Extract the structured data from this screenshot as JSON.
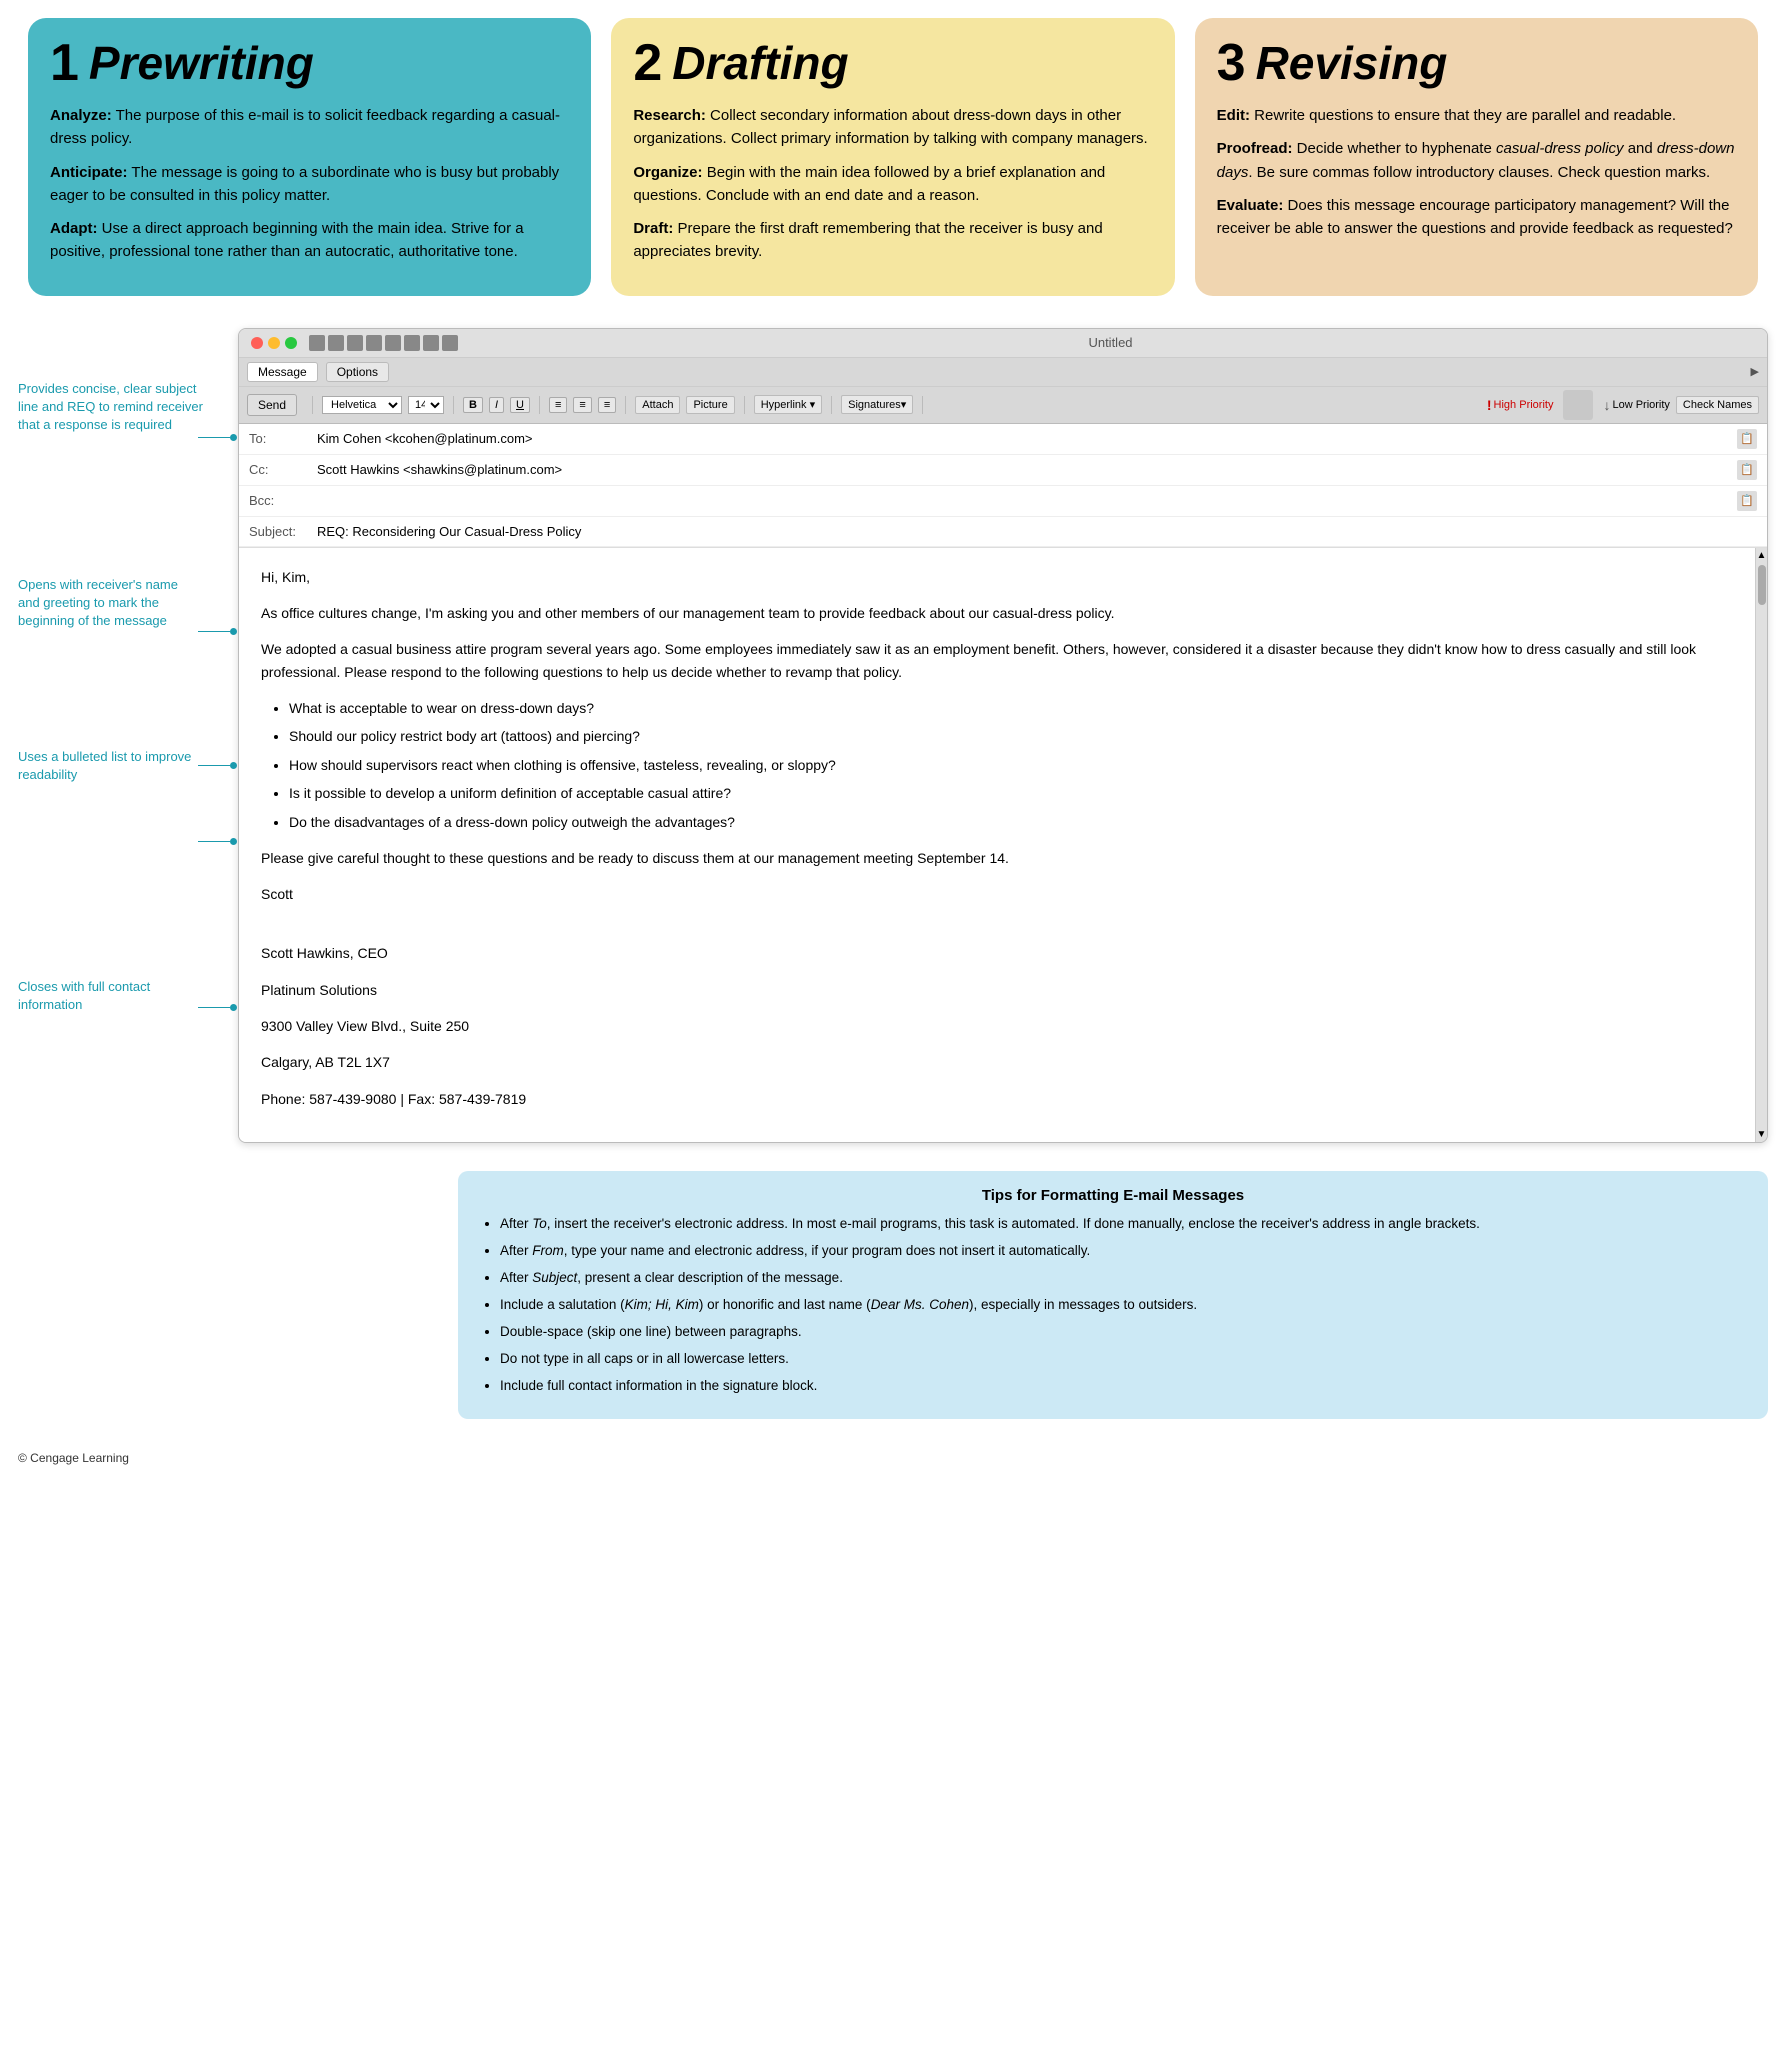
{
  "topPanels": [
    {
      "number": "1",
      "title": "Prewriting",
      "items": [
        {
          "label": "Analyze:",
          "text": "The purpose of this e-mail is to solicit feedback regarding a casual-dress policy."
        },
        {
          "label": "Anticipate:",
          "text": "The message is going to a subordinate who is busy but probably eager to be consulted in this policy matter."
        },
        {
          "label": "Adapt:",
          "text": "Use a direct approach beginning with the main idea. Strive for a positive, professional tone rather than an autocratic, authoritative tone."
        }
      ]
    },
    {
      "number": "2",
      "title": "Drafting",
      "items": [
        {
          "label": "Research:",
          "text": "Collect secondary information about dress-down days in other organizations. Collect primary information by talking with company managers."
        },
        {
          "label": "Organize:",
          "text": "Begin with the main idea followed by a brief explanation and questions. Conclude with an end date and a reason."
        },
        {
          "label": "Draft:",
          "text": "Prepare the first draft remembering that the receiver is busy and appreciates brevity."
        }
      ]
    },
    {
      "number": "3",
      "title": "Revising",
      "items": [
        {
          "label": "Edit:",
          "text": "Rewrite questions to ensure that they are parallel and readable."
        },
        {
          "label": "Proofread:",
          "text": "Decide whether to hyphenate casual-dress policy and dress-down days. Be sure commas follow introductory clauses. Check question marks."
        },
        {
          "label": "Evaluate:",
          "text": "Does this message encourage participatory management? Will the receiver be able to answer the questions and provide feedback as requested?"
        }
      ]
    }
  ],
  "emailWindow": {
    "title": "Untitled",
    "toolbar": {
      "tabs": [
        "Message",
        "Options"
      ],
      "fontFamily": "Helvetica",
      "fontSize": "14",
      "sendBtn": "Send",
      "attachBtn": "Attach",
      "pictureBtn": "Picture",
      "signaturesBtn": "Signatures▾",
      "highPriorityBtn": "High Priority",
      "lowPriorityBtn": "Low Priority",
      "checkNamesBtn": "Check Names",
      "hyperlinkBtn": "Hyperlink ▾"
    },
    "fields": {
      "to": {
        "label": "To:",
        "value": "Kim Cohen <kcohen@platinum.com>"
      },
      "cc": {
        "label": "Cc:",
        "value": "Scott Hawkins <shawkins@platinum.com>"
      },
      "bcc": {
        "label": "Bcc:",
        "value": ""
      },
      "subject": {
        "label": "Subject:",
        "value": "REQ: Reconsidering Our Casual-Dress Policy"
      }
    },
    "body": {
      "greeting": "Hi, Kim,",
      "para1": "As office cultures change, I'm asking you and other members of our management team to provide feedback about our casual-dress policy.",
      "para2": "We adopted a casual business attire program several years ago. Some employees immediately saw it as an employment benefit. Others, however, considered it a disaster because they didn't know how to dress casually and still look professional. Please respond to the following questions to help us decide whether to revamp that policy.",
      "bullets": [
        "What is acceptable to wear on dress-down days?",
        "Should our policy restrict body art (tattoos) and piercing?",
        "How should supervisors react when clothing is offensive, tasteless, revealing, or sloppy?",
        "Is it possible to develop a uniform definition of acceptable casual attire?",
        "Do the disadvantages of a dress-down policy outweigh the advantages?"
      ],
      "closing": "Please give careful thought to these questions and be ready to discuss them at our management meeting September 14.",
      "signatureName": "Scott",
      "signatureBlock": [
        "Scott Hawkins, CEO",
        "Platinum Solutions",
        "9300 Valley View Blvd., Suite 250",
        "Calgary, AB  T2L 1X7",
        "Phone: 587-439-9080  |  Fax: 587-439-7819"
      ]
    }
  },
  "annotations": [
    {
      "id": "ann1",
      "text": "Provides concise, clear subject line and REQ to remind receiver that a response is required"
    },
    {
      "id": "ann2",
      "text": "Opens with receiver's name and greeting to mark the beginning of the message"
    },
    {
      "id": "ann3",
      "text": "Uses a bulleted list to improve readability"
    },
    {
      "id": "ann4",
      "text": "Closes with full contact information"
    }
  ],
  "tipsBox": {
    "title": "Tips for Formatting E-mail Messages",
    "items": [
      "After To, insert the receiver's electronic address. In most e-mail programs, this task is automated. If done manually, enclose the receiver's address in angle brackets.",
      "After From, type your name and electronic address, if your program does not insert it automatically.",
      "After Subject, present a clear description of the message.",
      "Include a salutation (Kim; Hi, Kim) or honorific and last name (Dear Ms. Cohen), especially in messages to outsiders.",
      "Double-space (skip one line) between paragraphs.",
      "Do not type in all caps or in all lowercase letters.",
      "Include full contact information in the signature block."
    ]
  },
  "copyright": "© Cengage Learning"
}
